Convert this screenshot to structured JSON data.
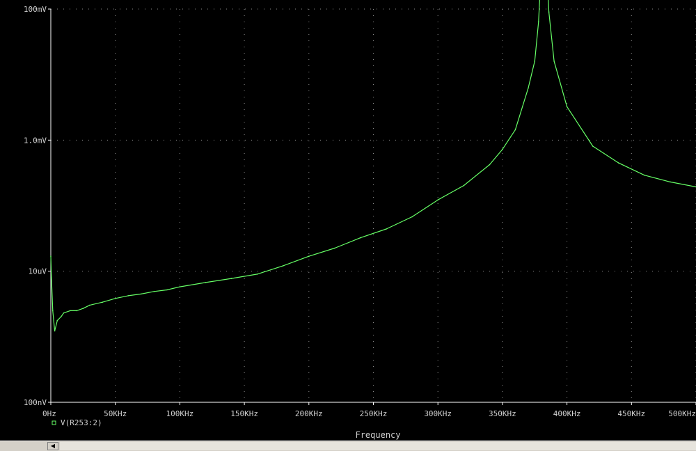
{
  "chart_data": {
    "type": "line",
    "xlabel": "Frequency",
    "ylabel": "",
    "xlim": [
      0,
      500000
    ],
    "ylim": [
      1e-07,
      0.0001
    ],
    "y_scale": "log",
    "grid": true,
    "legend_position": "bottom-left",
    "x_ticks": [
      "0Hz",
      "50KHz",
      "100KHz",
      "150KHz",
      "200KHz",
      "250KHz",
      "300KHz",
      "350KHz",
      "400KHz",
      "450KHz",
      "500KHz"
    ],
    "y_ticks": [
      "100mV",
      "1.0mV",
      "10uV",
      "100nV"
    ],
    "series": [
      {
        "name": "V(R253:2)",
        "color": "#66ff66",
        "points": [
          [
            0,
            1.3e-06
          ],
          [
            500,
            9e-07
          ],
          [
            1500,
            5e-07
          ],
          [
            3000,
            3.5e-07
          ],
          [
            5000,
            4.2e-07
          ],
          [
            8000,
            4.5e-07
          ],
          [
            10000,
            4.8e-07
          ],
          [
            15000,
            5e-07
          ],
          [
            20000,
            5e-07
          ],
          [
            25000,
            5.2e-07
          ],
          [
            30000,
            5.5e-07
          ],
          [
            40000,
            5.8e-07
          ],
          [
            50000,
            6.2e-07
          ],
          [
            60000,
            6.5e-07
          ],
          [
            70000,
            6.7e-07
          ],
          [
            80000,
            7e-07
          ],
          [
            90000,
            7.2e-07
          ],
          [
            100000,
            7.6e-07
          ],
          [
            120000,
            8.2e-07
          ],
          [
            140000,
            8.8e-07
          ],
          [
            160000,
            9.5e-07
          ],
          [
            180000,
            1.1e-06
          ],
          [
            200000,
            1.3e-06
          ],
          [
            220000,
            1.5e-06
          ],
          [
            240000,
            1.8e-06
          ],
          [
            260000,
            2.1e-06
          ],
          [
            280000,
            2.6e-06
          ],
          [
            300000,
            3.5e-06
          ],
          [
            320000,
            4.5e-06
          ],
          [
            340000,
            6.5e-06
          ],
          [
            350000,
            8.5e-06
          ],
          [
            360000,
            1.2e-05
          ],
          [
            370000,
            2.5e-05
          ],
          [
            375000,
            4e-05
          ],
          [
            378000,
            8e-05
          ],
          [
            380000,
            0.0002
          ],
          [
            382000,
            0.00045
          ],
          [
            383000,
            0.0005
          ],
          [
            384000,
            0.00025
          ],
          [
            386000,
            9.5e-05
          ],
          [
            390000,
            4e-05
          ],
          [
            400000,
            1.8e-05
          ],
          [
            420000,
            9e-06
          ],
          [
            440000,
            6.7e-06
          ],
          [
            460000,
            5.4e-06
          ],
          [
            480000,
            4.8e-06
          ],
          [
            500000,
            4.4e-06
          ]
        ]
      }
    ]
  }
}
